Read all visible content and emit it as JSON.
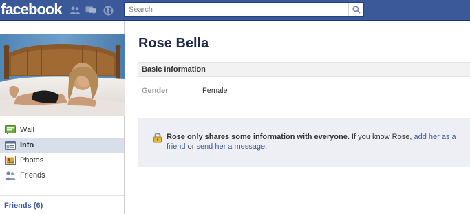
{
  "topbar": {
    "logo_text": "facebook",
    "brand_color": "#3b5998",
    "jewels": [
      "friend-requests-icon",
      "messages-icon",
      "notifications-globe-icon"
    ]
  },
  "search": {
    "placeholder": "Search",
    "value": ""
  },
  "sidebar": {
    "items": [
      {
        "label": "Wall",
        "icon": "wall-icon",
        "active": false
      },
      {
        "label": "Info",
        "icon": "info-icon",
        "active": true
      },
      {
        "label": "Photos",
        "icon": "photos-icon",
        "active": false
      },
      {
        "label": "Friends",
        "icon": "friends-icon",
        "active": false
      }
    ],
    "friends_heading": "Friends (6)"
  },
  "profile": {
    "name": "Rose Bella",
    "section_title": "Basic Information",
    "fields": [
      {
        "label": "Gender",
        "value": "Female"
      }
    ]
  },
  "notice": {
    "bold_text": "Rose only shares some information with everyone.",
    "plain_1": " If you know Rose, ",
    "link_1": "add her as a friend",
    "plain_2": " or ",
    "link_2": "send her a message",
    "plain_3": "."
  }
}
